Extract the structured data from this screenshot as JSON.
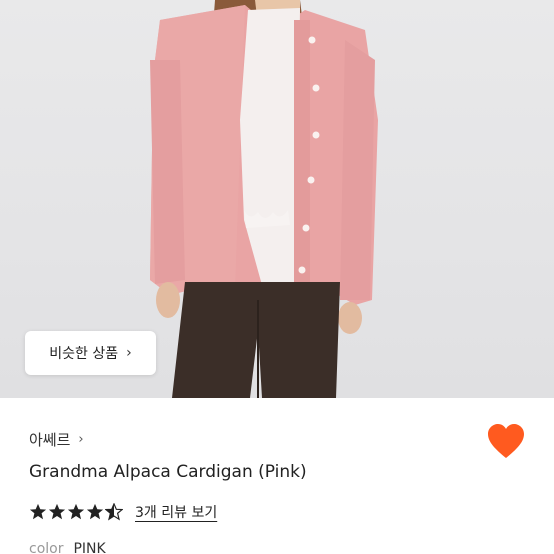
{
  "photo": {
    "alt": "product-photo",
    "similar_button": {
      "label": "비슷한 상품",
      "chevron": "›"
    }
  },
  "brand": {
    "name": "아쎄르",
    "chevron": "›"
  },
  "favorite": {
    "icon": "heart-icon",
    "color": "#ff5a1f",
    "active": true
  },
  "product": {
    "name": "Grandma Alpaca Cardigan (Pink)"
  },
  "rating": {
    "stars": 4.5,
    "max": 5,
    "review_link": "3개 리뷰 보기"
  },
  "spec": {
    "label": "color",
    "value": "PINK"
  },
  "colors": {
    "accent": "#ff5a1f",
    "cardigan": "#e9a4a4",
    "trousers": "#3b2e28"
  }
}
